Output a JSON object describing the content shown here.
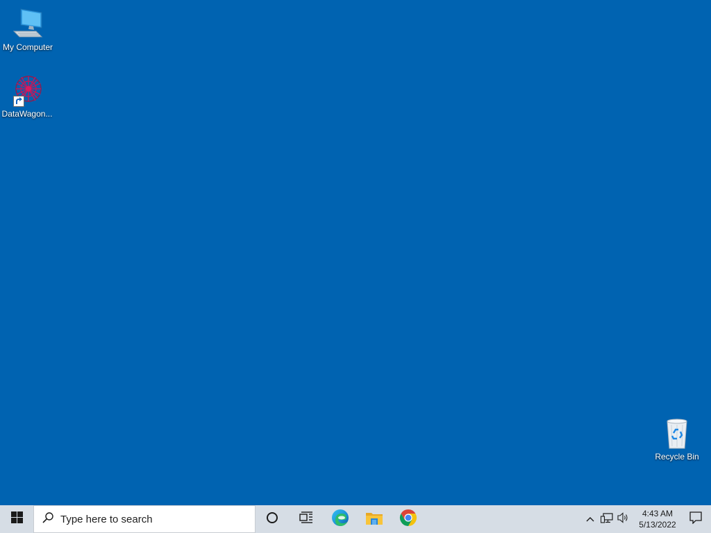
{
  "desktop": {
    "background_color": "#0063b1",
    "icons": [
      {
        "label": "My Computer",
        "icon": "computer-icon"
      },
      {
        "label": "DataWagon...",
        "icon": "datawagon-icon"
      },
      {
        "label": "Recycle Bin",
        "icon": "recycle-bin-icon"
      }
    ]
  },
  "taskbar": {
    "search_placeholder": "Type here to search",
    "apps": [
      {
        "name": "Cortana",
        "icon": "cortana-icon"
      },
      {
        "name": "Task View",
        "icon": "task-view-icon"
      },
      {
        "name": "Microsoft Edge",
        "icon": "edge-icon"
      },
      {
        "name": "File Explorer",
        "icon": "file-explorer-icon"
      },
      {
        "name": "Google Chrome",
        "icon": "chrome-icon"
      }
    ],
    "tray": {
      "icons": [
        "chevron-up-icon",
        "network-icon",
        "volume-icon"
      ],
      "time": "4:43 AM",
      "date": "5/13/2022"
    }
  }
}
